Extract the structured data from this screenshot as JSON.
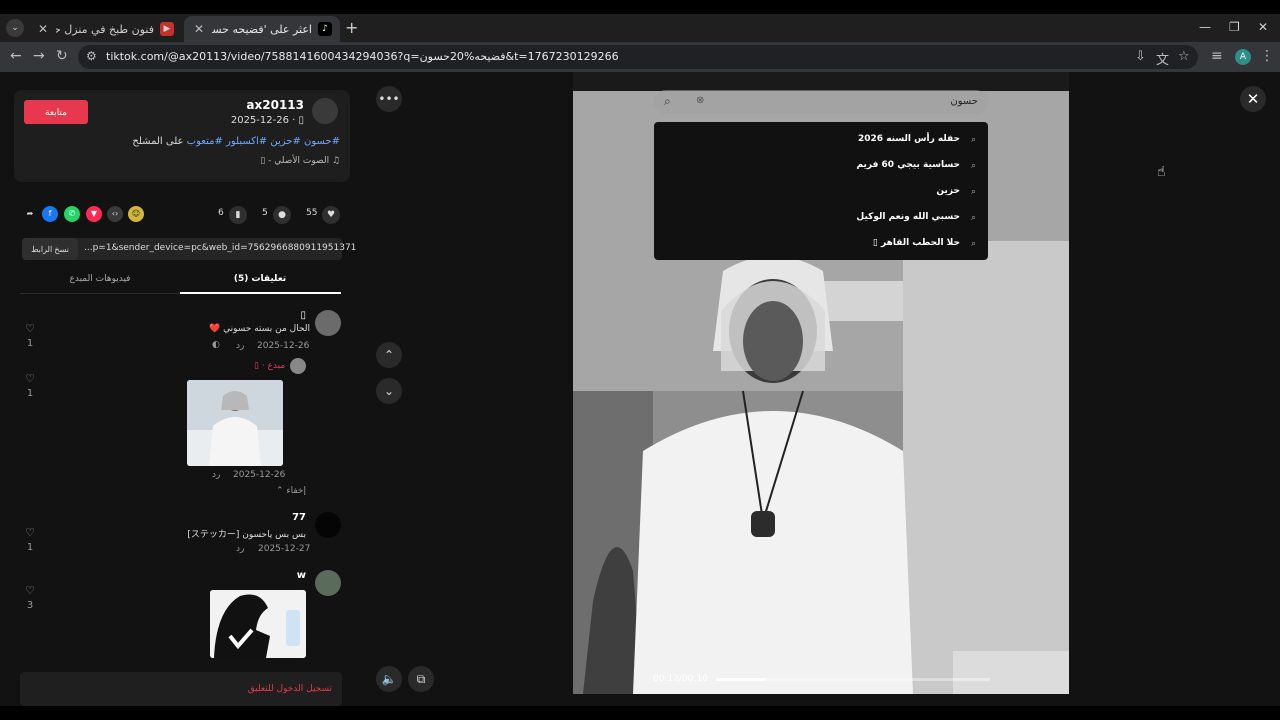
{
  "browser": {
    "tabs": [
      {
        "label": "فنون طبخ في منزل حسين البارقي",
        "active": false
      },
      {
        "label": "اعثر على 'فضيحه حسون' علـ",
        "active": true
      }
    ],
    "url": "tiktok.com/@ax20113/video/7588141600434294036?q=فضيحه%20حسون&t=1767230129266",
    "new_tab": "+",
    "profile_initial": "A"
  },
  "post": {
    "author": "ax20113",
    "date": "2025-12-26 · ▯",
    "follow_label": "متابعة",
    "caption_tags": "#حسون #حزين #اكسبلور #متعوب",
    "caption_text": " على المشلح",
    "sound": "♫ الصوت الأصلي - ▯",
    "likes": "55",
    "comments_count": "5",
    "saves": "6",
    "link_text": "...p=1&sender_device=pc&web_id=7562966880911951371",
    "copy_label": "نسخ الرابط"
  },
  "tabs2": {
    "comments_label": "(5) تعليقات",
    "creator_videos_label": "فيديوهات المبدع"
  },
  "comments": [
    {
      "name": "▯",
      "text": "الحال من بسته حسوني ❤️",
      "date": "2025-12-26",
      "reply": "رد",
      "likes": "1",
      "creator_tag": "▯ · مبدع"
    },
    {
      "name": "",
      "text": "",
      "date": "2025-12-26",
      "reply": "رد",
      "likes": "1",
      "hide": "إخفاء"
    },
    {
      "name": "77",
      "text": "بس بس ياحسون [ステッカー]",
      "date": "2025-12-27",
      "reply": "رد",
      "likes": "1"
    },
    {
      "name": "w",
      "text": "",
      "date": "",
      "reply": "",
      "likes": "3"
    }
  ],
  "login_prompt": "تسجيل الدخول للتعليق",
  "search": {
    "query": "حسون",
    "suggestions": [
      "حفله رأس السنه 2026",
      "حساسية بيجي 60 فريم",
      "حزين",
      "حسبي الله ونعم الوكيل",
      "حلا الحطب القاهر ▯"
    ]
  },
  "player": {
    "time": "00:12/00:10",
    "progress_fraction": 0.18
  }
}
